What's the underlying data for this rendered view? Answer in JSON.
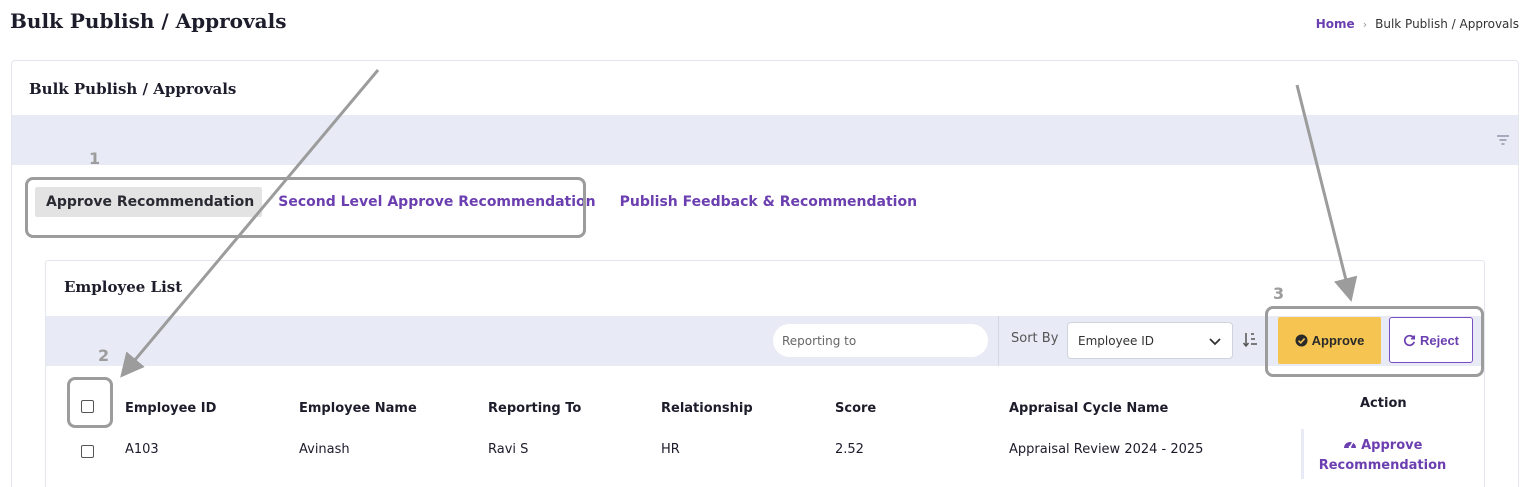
{
  "page": {
    "title": "Bulk Publish / Approvals",
    "breadcrumb": {
      "home": "Home",
      "current": "Bulk Publish / Approvals"
    }
  },
  "card": {
    "title": "Bulk Publish / Approvals",
    "filter_icon": "filter-icon"
  },
  "tabs": [
    {
      "label": "Approve Recommendation",
      "active": true
    },
    {
      "label": "Second Level Approve Recommendation",
      "active": false
    },
    {
      "label": "Publish Feedback & Recommendation",
      "active": false
    }
  ],
  "employee_list": {
    "title": "Employee List",
    "search_placeholder": "Reporting to",
    "sort_label": "Sort By",
    "sort_value": "Employee ID",
    "approve_label": "Approve",
    "reject_label": "Reject",
    "columns": [
      "Employee ID",
      "Employee Name",
      "Reporting To",
      "Relationship",
      "Score",
      "Appraisal Cycle Name",
      "Action"
    ],
    "rows": [
      {
        "employee_id": "A103",
        "employee_name": "Avinash",
        "reporting_to": "Ravi S",
        "relationship": "HR",
        "score": "2.52",
        "appraisal_cycle": "Appraisal Review 2024 - 2025",
        "action": "Approve Recommendation"
      }
    ]
  },
  "annotations": {
    "n1": "1",
    "n2": "2",
    "n3": "3"
  },
  "colors": {
    "accent": "#6b3fb0",
    "approve": "#f5c451",
    "toolbar": "#e8ebf5",
    "annotation": "#9c9c9c"
  }
}
